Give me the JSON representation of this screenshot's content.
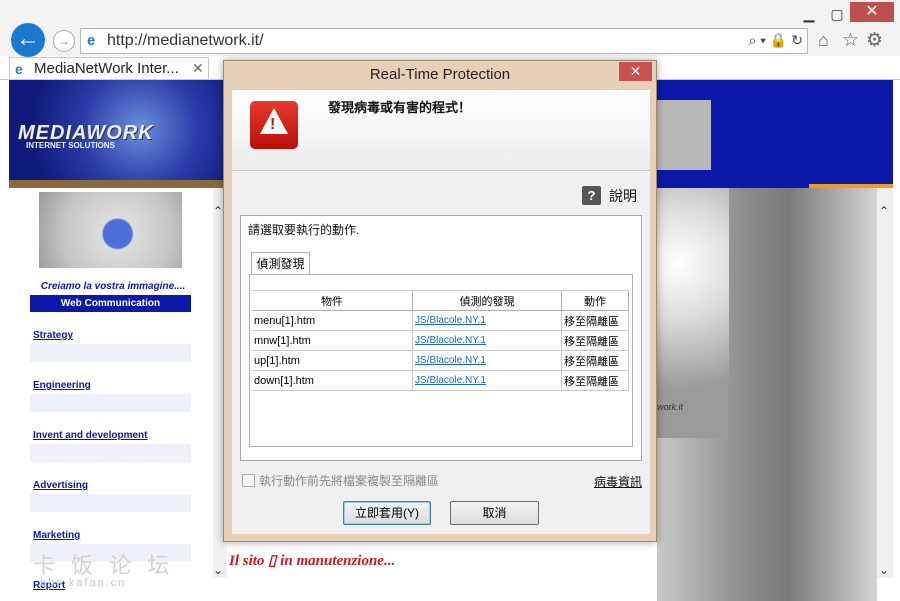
{
  "browser": {
    "url": "http://medianetwork.it/",
    "tab_title": "MediaNetWork Inter...",
    "tab_close": "✕",
    "window_buttons": {
      "minimize": "▁",
      "maximize": "▢",
      "close": "✕"
    },
    "icons": {
      "back": "back-arrow-icon",
      "forward": "forward-arrow-icon",
      "ie": "ie-logo-icon",
      "search": "search-icon",
      "refresh": "refresh-icon",
      "home": "home-icon",
      "favorites": "star-icon",
      "settings": "gear-icon"
    },
    "address_tools": "⌕ ▾ 🔒 ↻"
  },
  "website": {
    "logo_text": "MEDIAWORK",
    "logo_sub": "INTERNET SOLUTIONS",
    "tagline": "Creiamo la vostra immagine....",
    "section_header": "Web Communication",
    "menu": [
      "Strategy",
      "Engineering",
      "Invent and development",
      "Advertising",
      "Marketing",
      "Report"
    ],
    "image_caption": "work.it",
    "maintenance": "Il sito ▯ in manutenzione...",
    "watermark": "卡 饭 论 坛",
    "watermark_url": "bbs.kafan.cn"
  },
  "dialog": {
    "title": "Real-Time Protection",
    "close_label": "✕",
    "alert_message": "發現病毒或有害的程式！",
    "help_label": "說明",
    "help_icon": "?",
    "instruction": "請選取要執行的動作.",
    "tab_label": "偵測發現",
    "columns": [
      "物件",
      "偵測的發現",
      "動作"
    ],
    "rows": [
      {
        "object": "menu[1].htm",
        "detection": "JS/Blacole.NY.1",
        "action": "移至隔離區"
      },
      {
        "object": "mnw[1].htm",
        "detection": "JS/Blacole.NY.1",
        "action": "移至隔離區"
      },
      {
        "object": "up[1].htm",
        "detection": "JS/Blacole.NY.1",
        "action": "移至隔離區"
      },
      {
        "object": "down[1].htm",
        "detection": "JS/Blacole.NY.1",
        "action": "移至隔離區"
      }
    ],
    "checkbox_label": "執行動作前先將檔案複製至隔離區",
    "virus_info_link": "病毒資訊",
    "apply_button": "立即套用(Y)",
    "cancel_button": "取消"
  },
  "colors": {
    "site_blue": "#0c19a8",
    "alert_red": "#c0140c",
    "dialog_frame": "#e8d0b8",
    "maintenance_red": "#d01818"
  }
}
